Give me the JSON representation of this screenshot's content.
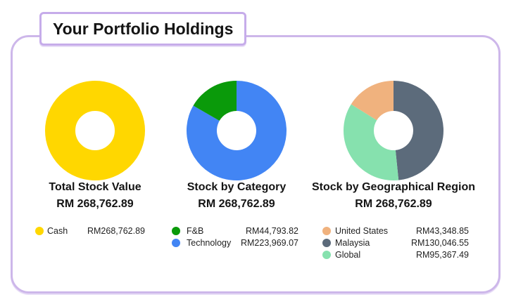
{
  "header": {
    "title": "Your Portfolio Holdings"
  },
  "chart_data": [
    {
      "type": "pie",
      "title": "Total Stock Value",
      "total": "RM 268,762.89",
      "categories": [
        "Cash"
      ],
      "values": [
        268762.89
      ],
      "value_labels": [
        "RM268,762.89"
      ],
      "colors": [
        "#FFD700"
      ]
    },
    {
      "type": "pie",
      "title": "Stock by Category",
      "total": "RM 268,762.89",
      "categories": [
        "F&B",
        "Technology"
      ],
      "values": [
        44793.82,
        223969.07
      ],
      "value_labels": [
        "RM44,793.82",
        "RM223,969.07"
      ],
      "colors": [
        "#0A9A0A",
        "#4285F4"
      ]
    },
    {
      "type": "pie",
      "title": "Stock by Geographical Region",
      "total": "RM 268,762.89",
      "categories": [
        "United States",
        "Malaysia",
        "Global"
      ],
      "values": [
        43348.85,
        130046.55,
        95367.49
      ],
      "value_labels": [
        "RM43,348.85",
        "RM130,046.55",
        "RM95,367.49"
      ],
      "colors": [
        "#F0B27E",
        "#5C6B7B",
        "#86E1AE"
      ]
    }
  ]
}
